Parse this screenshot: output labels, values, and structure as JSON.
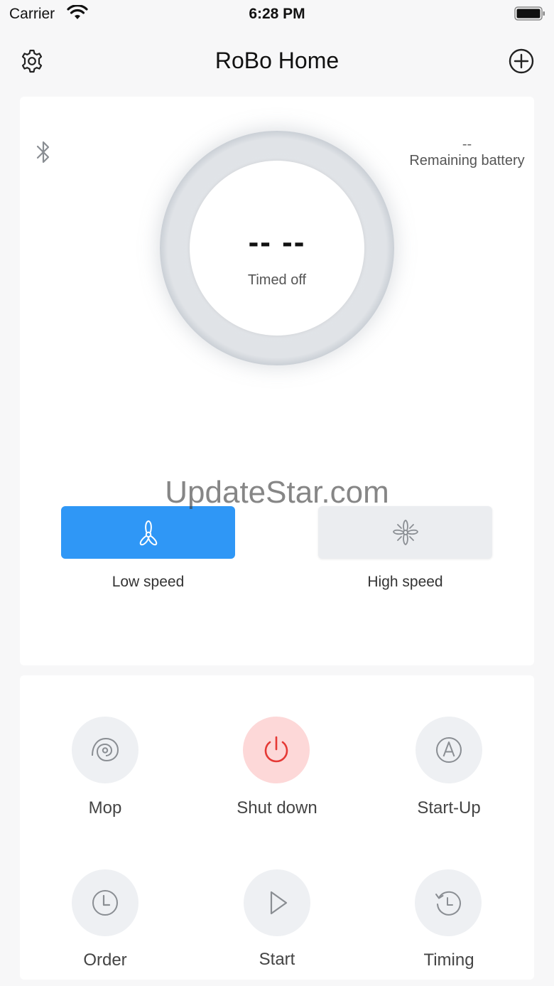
{
  "status_bar": {
    "carrier": "Carrier",
    "time": "6:28 PM"
  },
  "nav": {
    "title": "RoBo Home",
    "left_icon": "gear-icon",
    "right_icon": "plus-circle-icon"
  },
  "device": {
    "bluetooth_icon": "bluetooth-icon",
    "battery_value": "--",
    "battery_label": "Remaining battery",
    "timer_value": "-- --",
    "timer_label": "Timed off"
  },
  "watermark": "UpdateStar.com",
  "speed": {
    "selected": "low",
    "options": [
      {
        "id": "low",
        "label": "Low speed",
        "icon": "fan-low-icon"
      },
      {
        "id": "high",
        "label": "High speed",
        "icon": "fan-high-icon"
      }
    ]
  },
  "controls": [
    {
      "label": "Mop",
      "icon": "mop-icon"
    },
    {
      "label": "Shut down",
      "icon": "power-icon"
    },
    {
      "label": "Start-Up",
      "icon": "auto-icon"
    },
    {
      "label": "Order",
      "icon": "clock-icon"
    },
    {
      "label": "Start",
      "icon": "play-icon"
    },
    {
      "label": "Timing",
      "icon": "timer-reset-icon"
    }
  ],
  "colors": {
    "accent": "#2f97f6",
    "danger": "#e53935",
    "danger_bg": "#fdd8d8",
    "icon_gray": "#8a8e93"
  }
}
